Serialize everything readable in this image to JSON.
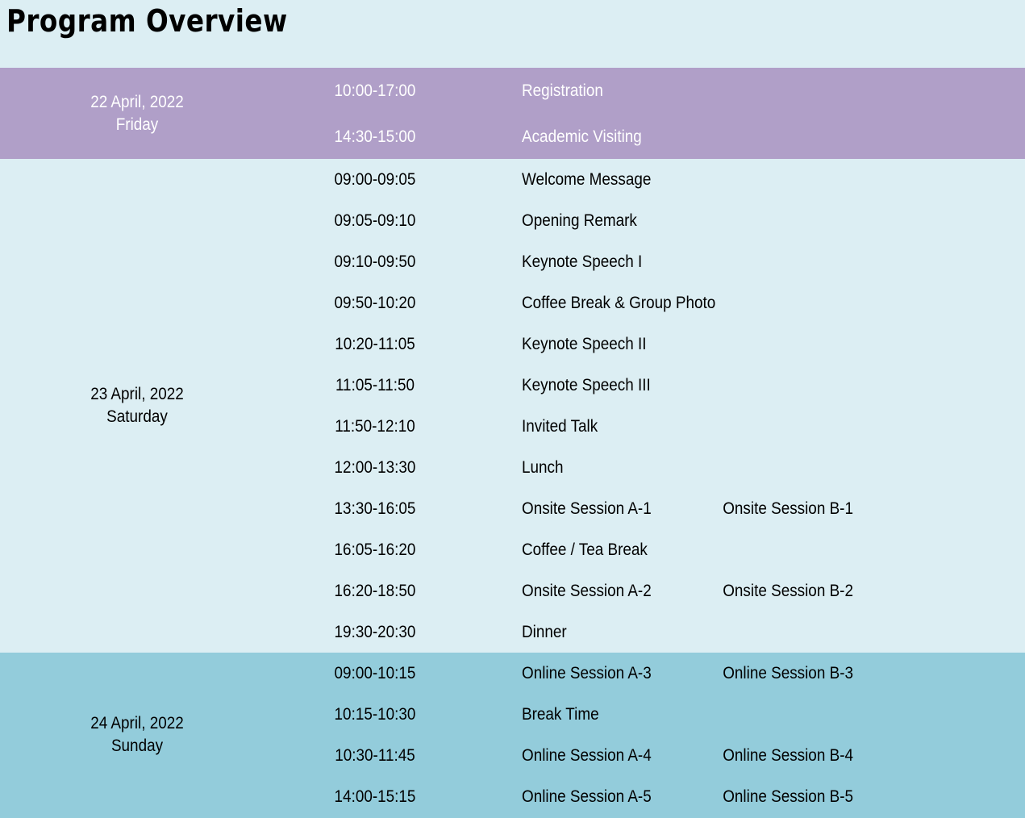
{
  "title": "Program Overview",
  "colors": {
    "page_bg": "#dceef3",
    "day1_bg": "#b09fc8",
    "day2_bg": "#dceef3",
    "day3_bg": "#93ccdb"
  },
  "days": [
    {
      "date": "22 April, 2022",
      "weekday": "Friday",
      "rows": [
        {
          "time": "10:00-17:00",
          "event": "Registration",
          "event2": ""
        },
        {
          "time": "14:30-15:00",
          "event": "Academic Visiting",
          "event2": ""
        }
      ]
    },
    {
      "date": "23 April, 2022",
      "weekday": "Saturday",
      "rows": [
        {
          "time": "09:00-09:05",
          "event": "Welcome Message",
          "event2": ""
        },
        {
          "time": "09:05-09:10",
          "event": "Opening Remark",
          "event2": ""
        },
        {
          "time": "09:10-09:50",
          "event": "Keynote Speech I",
          "event2": ""
        },
        {
          "time": "09:50-10:20",
          "event": "Coffee Break & Group Photo",
          "event2": ""
        },
        {
          "time": "10:20-11:05",
          "event": "Keynote Speech II",
          "event2": ""
        },
        {
          "time": "11:05-11:50",
          "event": "Keynote Speech III",
          "event2": ""
        },
        {
          "time": "11:50-12:10",
          "event": "Invited Talk",
          "event2": ""
        },
        {
          "time": "12:00-13:30",
          "event": "Lunch",
          "event2": ""
        },
        {
          "time": "13:30-16:05",
          "event": "Onsite Session A-1",
          "event2": "Onsite Session B-1"
        },
        {
          "time": "16:05-16:20",
          "event": "Coffee / Tea Break",
          "event2": ""
        },
        {
          "time": "16:20-18:50",
          "event": "Onsite Session A-2",
          "event2": "Onsite Session B-2"
        },
        {
          "time": "19:30-20:30",
          "event": "Dinner",
          "event2": ""
        }
      ]
    },
    {
      "date": "24 April, 2022",
      "weekday": "Sunday",
      "rows": [
        {
          "time": "09:00-10:15",
          "event": "Online Session A-3",
          "event2": "Online Session B-3"
        },
        {
          "time": "10:15-10:30",
          "event": "Break Time",
          "event2": ""
        },
        {
          "time": "10:30-11:45",
          "event": "Online Session A-4",
          "event2": "Online Session B-4"
        },
        {
          "time": "14:00-15:15",
          "event": "Online Session A-5",
          "event2": "Online Session B-5"
        }
      ]
    }
  ]
}
